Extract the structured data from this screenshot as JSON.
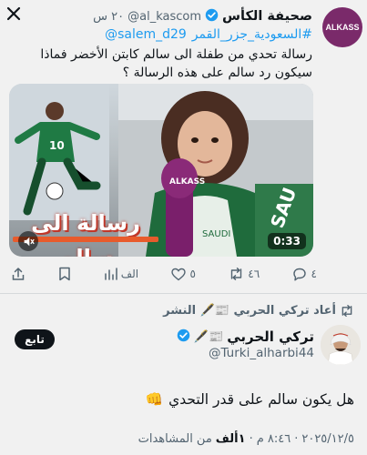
{
  "quoted_tweet": {
    "display_name": "صحيفة الكأس",
    "handle": "@al_kascom",
    "time": "٢٠ س",
    "avatar_text": "ALKASS",
    "hashtags": [
      "#السعودية_جزر_القمر",
      "@salem_d29"
    ],
    "text": "رسالة تحدي من طفلة الى سالم كابتن الأخضر فماذا سيكون رد سالم على هذه الرسالة ؟",
    "media": {
      "caption": "رسالة الى سالم",
      "duration": "0:33",
      "player_number": "10",
      "mic_brand": "ALKASS"
    },
    "actions": {
      "replies": "٤",
      "reposts": "٤٦",
      "likes": "٥",
      "views": "الف"
    }
  },
  "repost_banner": "أعاد تركي الحربي 📰🖋️ النشر",
  "main_tweet": {
    "display_name": "تركي الحربي",
    "emoji": "📰🖋️",
    "handle": "@Turki_alharbi44",
    "follow_label": "تابع",
    "text": "هل يكون سالم على قدر التحدي",
    "text_emoji": "👊",
    "meta_time": "٨:٤٦ م",
    "meta_date": "٢٠٢٥/١٢/٥",
    "meta_views_num": "١ألف",
    "meta_views_label": "من المشاهدات"
  },
  "colors": {
    "link": "#1d9bf0",
    "verified": "#1d9bf0",
    "muted": "#536471",
    "background": "#f1f1f1"
  },
  "icons": [
    "close-icon",
    "verified-icon",
    "reply-icon",
    "repost-icon",
    "like-icon",
    "views-icon",
    "bookmark-icon",
    "share-icon",
    "mute-icon"
  ]
}
